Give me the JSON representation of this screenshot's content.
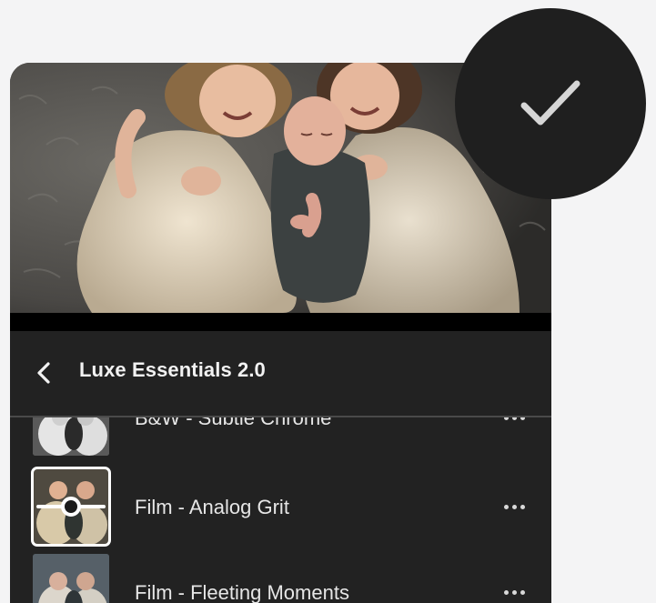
{
  "header": {
    "title": "Luxe Essentials 2.0",
    "back_icon": "chevron-left-icon"
  },
  "confirm": {
    "icon": "checkmark-icon"
  },
  "presets": [
    {
      "label": "B&W - Subtle Chrome",
      "thumb_style": "bw",
      "selected": false
    },
    {
      "label": "Film - Analog Grit",
      "thumb_style": "color",
      "selected": true
    },
    {
      "label": "Film - Fleeting Moments",
      "thumb_style": "cool",
      "selected": false
    }
  ],
  "colors": {
    "panel_bg": "#222222",
    "page_bg": "#f4f4f5",
    "text": "#e6e6e6",
    "confirm_bg": "#1f1f1f",
    "check": "#d6d6d6"
  }
}
